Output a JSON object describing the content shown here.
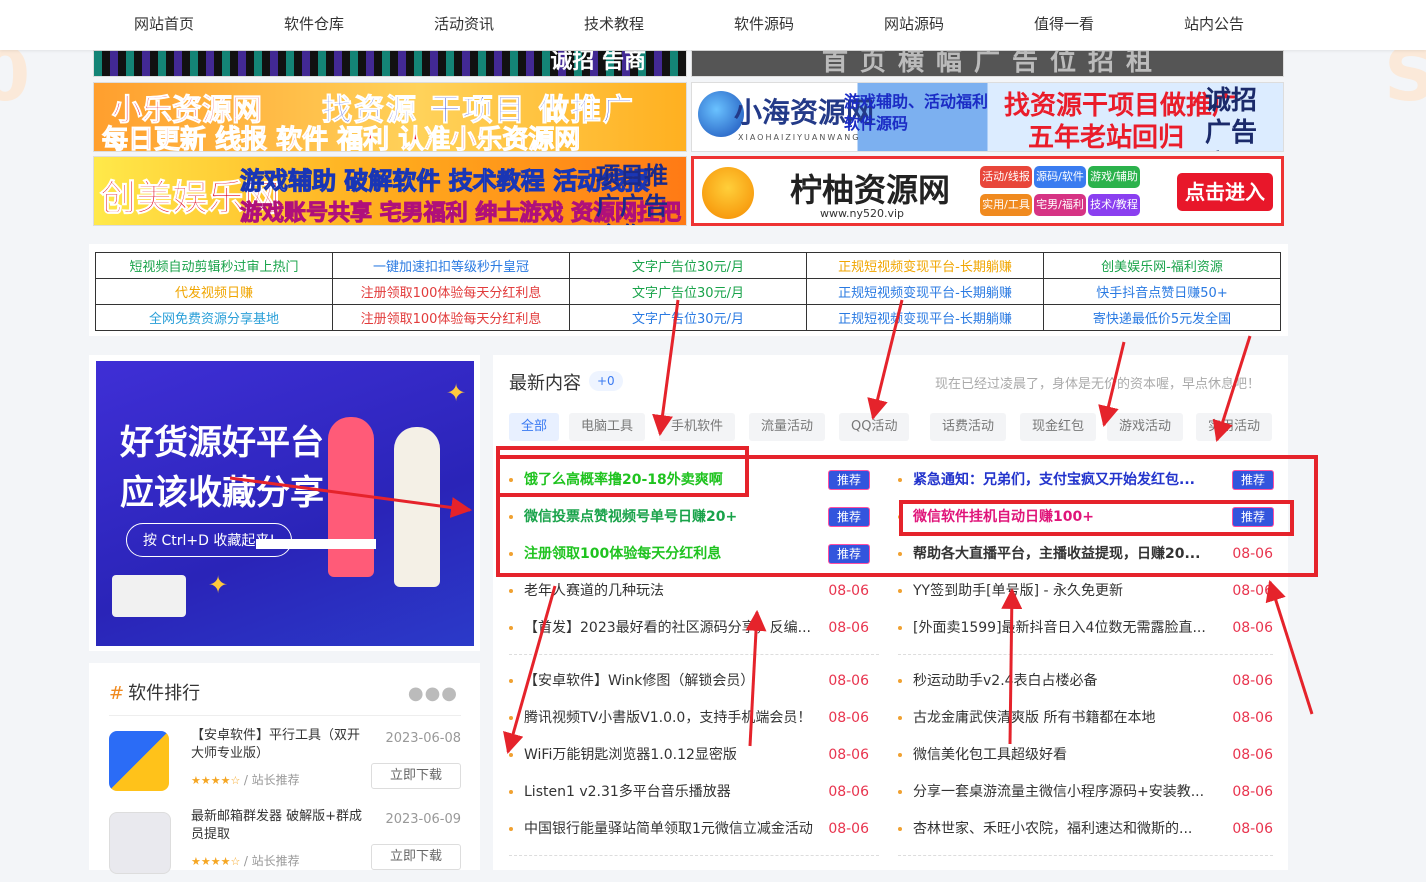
{
  "nav": [
    "网站首页",
    "软件仓库",
    "活动资讯",
    "技术教程",
    "软件源码",
    "网站源码",
    "值得一看",
    "站内公告"
  ],
  "banners": {
    "top_left_text": "诚招 告商",
    "top_right_text": "首页横幅广告位招租",
    "xiaole": {
      "line1": "小乐资源网",
      "line2": "找资源 干项目 做推广",
      "line3": "每日更新 线报 软件 福利 认准小乐资源网"
    },
    "xiaohai": {
      "name": "小海资源网",
      "pinyin": "XIAOHAIZIYUANWANG",
      "tags": "游戏辅助、活动福利 软件源码",
      "slogan1": "找资源干项目做推广",
      "slogan2": "五年老站回归",
      "ad": "诚招广告商"
    },
    "chuangmei": {
      "name": "创美娱乐网",
      "line1": "游戏辅助 破解软件 技术教程 活动线报",
      "line2": "游戏账号共享 宅男福利 绅士游戏 资源网扛把子",
      "ad": "项目推广广告合作"
    },
    "ningyou": {
      "name": "柠柚资源网",
      "url": "www.ny520.vip",
      "tags": [
        "活动/线报",
        "源码/软件",
        "游戏/辅助",
        "实用/工具",
        "宅男/福利",
        "技术/教程"
      ],
      "tag_colors": [
        "#e8463a",
        "#3a7cf0",
        "#2bb24c",
        "#f08a1f",
        "#d63384",
        "#8a3ff0"
      ],
      "button": "点击进入"
    }
  },
  "link_table": [
    [
      {
        "t": "短视频自动剪辑秒过审上热门",
        "c": "#19a34a"
      },
      {
        "t": "一键加速扣扣等级秒升皇冠",
        "c": "#2a7ae2"
      },
      {
        "t": "文字广告位30元/月",
        "c": "#19a34a"
      },
      {
        "t": "正规短视频变现平台-长期躺赚",
        "c": "#f0a500"
      },
      {
        "t": "创美娱乐网-福利资源",
        "c": "#19a34a"
      }
    ],
    [
      {
        "t": "代发视频日赚",
        "c": "#f0a500"
      },
      {
        "t": "注册领取100体验每天分红利息",
        "c": "#e23b3b"
      },
      {
        "t": "文字广告位30元/月",
        "c": "#19a34a"
      },
      {
        "t": "正规短视频变现平台-长期躺赚",
        "c": "#2a7ae2"
      },
      {
        "t": "快手抖音点赞日赚50+",
        "c": "#2a7ae2"
      }
    ],
    [
      {
        "t": "全网免费资源分享基地",
        "c": "#2a9fd8"
      },
      {
        "t": "注册领取100体验每天分红利息",
        "c": "#e23b3b"
      },
      {
        "t": "文字广告位30元/月",
        "c": "#2a7ae2"
      },
      {
        "t": "正规短视频变现平台-长期躺赚",
        "c": "#2a7ae2"
      },
      {
        "t": "寄快递最低价5元发全国",
        "c": "#2a7ae2"
      }
    ]
  ],
  "promo": {
    "line1": "好货源好平台",
    "line2": "应该收藏分享",
    "pill": "按 Ctrl+D 收藏起来!"
  },
  "rank": {
    "title": "软件排行",
    "download_label": "立即下载",
    "items": [
      {
        "name": "【安卓软件】平行工具（双开大师专业版）",
        "date": "2023-06-08",
        "stars": "★★★★☆",
        "by": "/ 站长推荐"
      },
      {
        "name": "最新邮箱群发器 破解版+群成员提取",
        "date": "2023-06-09",
        "stars": "★★★★☆",
        "by": "/ 站长推荐"
      }
    ]
  },
  "latest": {
    "title": "最新内容",
    "badge": "+0",
    "notice": "现在已经过凌晨了，身体是无价的资本喔，早点休息吧！",
    "tabs": [
      "全部",
      "电脑工具",
      "手机软件",
      "流量活动",
      "QQ活动",
      "话费活动",
      "现金红包",
      "游戏活动",
      "实用活动"
    ],
    "rec_label": "推荐",
    "left": [
      {
        "t": "饿了么高概率撸20-18外卖爽啊",
        "color": "#1fc31f",
        "bold": true,
        "rec": true
      },
      {
        "t": "微信投票点赞视频号单号日赚20+",
        "color": "#19a34a",
        "bold": true,
        "rec": true
      },
      {
        "t": "注册领取100体验每天分红利息",
        "color": "#1fc31f",
        "bold": true,
        "rec": true
      },
      {
        "t": "老年人赛道的几种玩法",
        "date": "08-06"
      },
      {
        "t": "【首发】2023最好看的社区源码分享，反编...",
        "date": "08-06"
      },
      {
        "t": "【安卓软件】Wink修图（解锁会员）",
        "date": "08-06"
      },
      {
        "t": "腾讯视频TV小書版V1.0.0，支持手机端会员！",
        "date": "08-06"
      },
      {
        "t": "WiFi万能钥匙浏览器1.0.12显密版",
        "date": "08-06"
      },
      {
        "t": "Listen1 v2.31多平台音乐播放器",
        "date": "08-06"
      },
      {
        "t": "中国银行能量驿站简单领取1元微信立减金活动",
        "date": "08-06"
      }
    ],
    "right": [
      {
        "t": "紧急通知：兄弟们，支付宝疯又开始发红包...",
        "color": "#2233cc",
        "bold": true,
        "rec": true
      },
      {
        "t": "微信软件挂机自动日赚100+",
        "color": "#e0157a",
        "bold": true,
        "rec": true
      },
      {
        "t": "帮助各大直播平台，主播收益提现，日赚20...",
        "color": "#333",
        "bold": true,
        "date": "08-06"
      },
      {
        "t": "YY签到助手[单号版] - 永久免更新",
        "date": "08-06"
      },
      {
        "t": "[外面卖1599]最新抖音日入4位数无需露脸直...",
        "date": "08-06"
      },
      {
        "t": "秒运动助手v2.4表白占楼必备",
        "date": "08-06"
      },
      {
        "t": "古龙金庸武侠清爽版 所有书籍都在本地",
        "date": "08-06"
      },
      {
        "t": "微信美化包工具超级好看",
        "date": "08-06"
      },
      {
        "t": "分享一套桌游流量主微信小程序源码+安装教...",
        "date": "08-06"
      },
      {
        "t": "杏林世家、禾旺小农院，福利速达和微斯的...",
        "date": "08-06"
      }
    ]
  }
}
